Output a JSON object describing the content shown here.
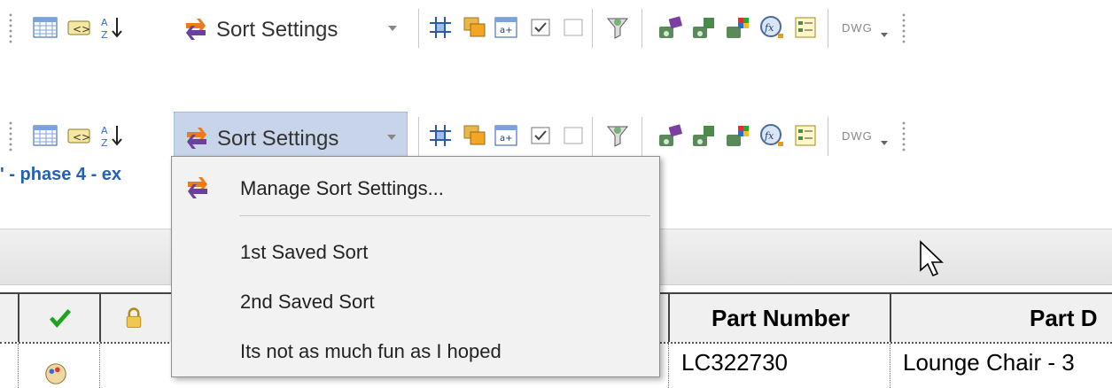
{
  "toolbar": {
    "sort_settings_label": "Sort Settings",
    "dwg_label": "DWG"
  },
  "breadcrumb": {
    "text": "' - phase 4 - ex"
  },
  "dropdown": {
    "items": [
      {
        "label": "Manage Sort Settings..."
      },
      {
        "label": "1st Saved Sort"
      },
      {
        "label": "2nd Saved Sort"
      },
      {
        "label": "Its not as much fun as I hoped"
      }
    ]
  },
  "table": {
    "headers": [
      "Part Number",
      "Part D"
    ],
    "row": [
      "LC322730",
      "Lounge Chair - 3"
    ]
  },
  "colors": {
    "menu_background": "#f2f2f2",
    "selected_button": "#c7d4ea",
    "breadcrumb_link": "#2460b8",
    "check_green": "#1ea31e"
  }
}
